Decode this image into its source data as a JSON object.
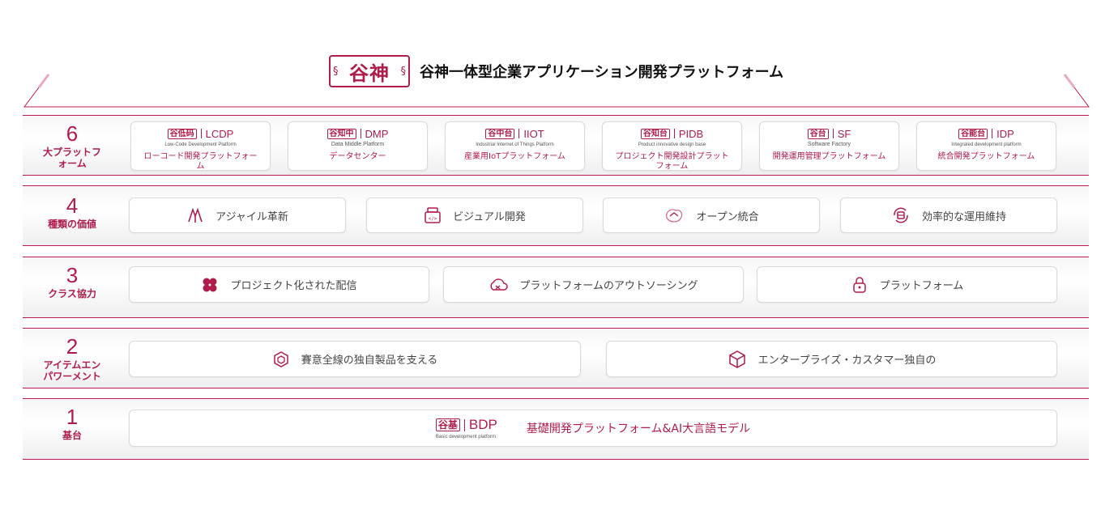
{
  "header": {
    "logo_text": "谷神",
    "title": "谷神一体型企業アプリケーション開発プラットフォーム"
  },
  "colors": {
    "accent": "#b01c4a"
  },
  "rows": [
    {
      "number": "6",
      "name_lines": [
        "大プラットフ",
        "ォーム"
      ],
      "products": [
        {
          "seal": "谷低码",
          "code": "LCDP",
          "subtitle": "Low-Code Development Platform",
          "name": "ローコード開発プラットフォーム"
        },
        {
          "seal": "谷知中",
          "code": "DMP",
          "subtitle": "Data Middle Platform",
          "name": "データセンター"
        },
        {
          "seal": "谷中台",
          "code": "IIOT",
          "subtitle": "Industrial Internet of Things Platform",
          "name": "産業用IoTプラットフォーム"
        },
        {
          "seal": "谷知台",
          "code": "PIDB",
          "subtitle": "Product innovative design base",
          "name": "プロジェクト開発設計プラットフォーム"
        },
        {
          "seal": "谷台",
          "code": "SF",
          "subtitle": "Software Factory",
          "name": "開発運用管理プラットフォーム"
        },
        {
          "seal": "谷能台",
          "code": "IDP",
          "subtitle": "Integrated development platform",
          "name": "統合開発プラットフォーム"
        }
      ]
    },
    {
      "number": "4",
      "name_lines": [
        "種類の価値"
      ],
      "items": [
        {
          "icon": "agile-icon",
          "label": "アジャイル革新"
        },
        {
          "icon": "visual-dev-icon",
          "label": "ビジュアル開発"
        },
        {
          "icon": "open-integration-icon",
          "label": "オープン統合"
        },
        {
          "icon": "maintenance-icon",
          "label": "効率的な運用維持"
        }
      ]
    },
    {
      "number": "3",
      "name_lines": [
        "クラス協力"
      ],
      "items": [
        {
          "icon": "clover-icon",
          "label": "プロジェクト化された配信"
        },
        {
          "icon": "cloud-outsourcing-icon",
          "label": "プラットフォームのアウトソーシング"
        },
        {
          "icon": "lock-icon",
          "label": "プラットフォーム"
        }
      ]
    },
    {
      "number": "2",
      "name_lines": [
        "アイテムエン",
        "パワーメント"
      ],
      "items": [
        {
          "icon": "cube-icon",
          "label": "賽意全線の独自製品を支える"
        },
        {
          "icon": "box-icon",
          "label": "エンタープライズ・カスタマー独自の"
        }
      ]
    },
    {
      "number": "1",
      "name_lines": [
        "基台"
      ],
      "base": {
        "seal": "谷基",
        "code": "BDP",
        "subtitle": "Basic development platform",
        "name": "基礎開発プラットフォーム&AI大言語モデル"
      }
    }
  ]
}
